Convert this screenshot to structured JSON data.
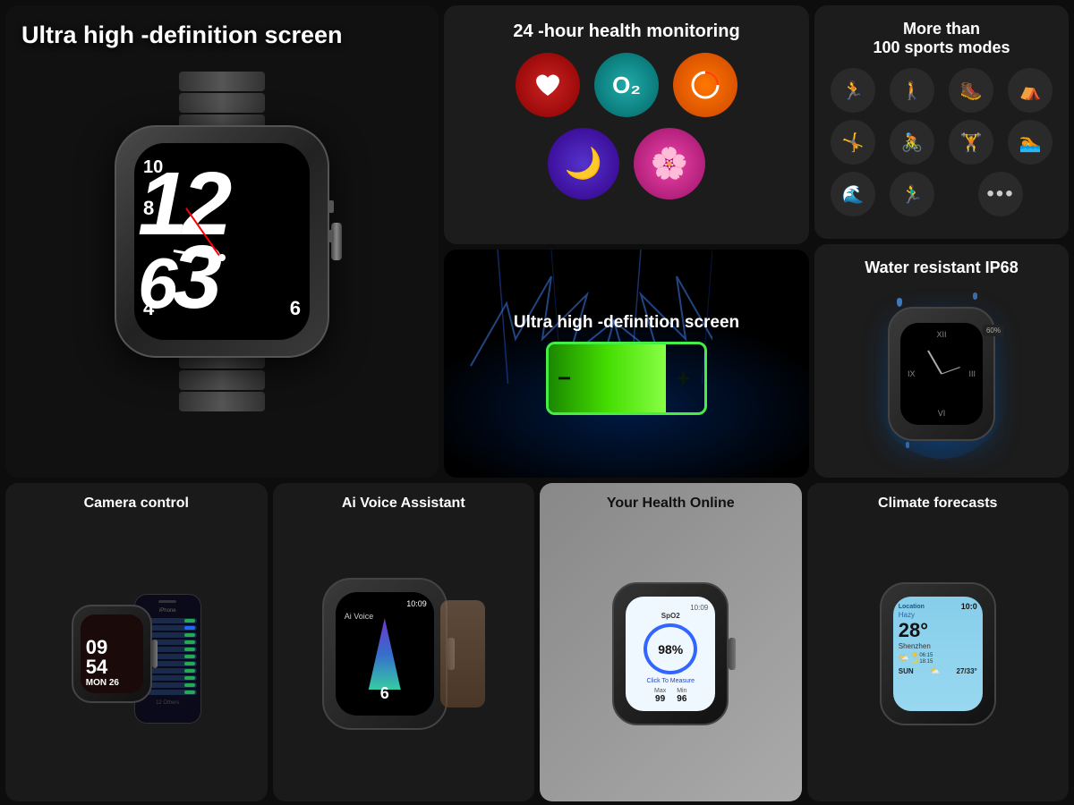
{
  "top_main": {
    "title": "Ultra high -definition screen"
  },
  "health": {
    "title": "24 -hour health monitoring",
    "icons": [
      {
        "emoji": "❤️",
        "bg": "#cc2222",
        "label": "heart-rate"
      },
      {
        "emoji": "💧",
        "bg": "#22aaaa",
        "label": "oxygen"
      },
      {
        "emoji": "🔄",
        "bg": "#ff7700",
        "label": "activity"
      },
      {
        "emoji": "🌙",
        "bg": "#7744cc",
        "label": "sleep"
      },
      {
        "emoji": "🌸",
        "bg": "#dd44aa",
        "label": "health-app"
      }
    ]
  },
  "sports": {
    "title": "More than\n100 sports modes",
    "icons": [
      {
        "emoji": "🏃",
        "color": "white",
        "label": "running"
      },
      {
        "emoji": "🚶",
        "color": "white",
        "label": "walking"
      },
      {
        "emoji": "🏔️",
        "color": "white",
        "label": "hiking"
      },
      {
        "emoji": "🏕️",
        "color": "white",
        "label": "outdoor"
      },
      {
        "emoji": "🤸",
        "color": "red",
        "label": "exercise"
      },
      {
        "emoji": "🚴",
        "color": "teal",
        "label": "cycling"
      },
      {
        "emoji": "🏋️",
        "color": "teal",
        "label": "gym"
      },
      {
        "emoji": "🏊",
        "color": "yellow",
        "label": "swimming"
      },
      {
        "emoji": "🌊",
        "color": "teal",
        "label": "water-sports"
      },
      {
        "emoji": "🏃‍♂️",
        "color": "orange",
        "label": "sprint"
      },
      {
        "emoji": "⋯",
        "color": "white",
        "label": "more"
      }
    ]
  },
  "battery": {
    "title": "Ultra high -definition screen",
    "minus": "−",
    "plus": "+"
  },
  "water": {
    "title": "Water resistant IP68"
  },
  "camera": {
    "title": "Camera control",
    "time": "09\n54",
    "day": "MON 26"
  },
  "voice": {
    "title": "Ai Voice Assistant",
    "time": "10:09"
  },
  "health_online": {
    "title": "Your Health Online",
    "spo2_label": "SpO2",
    "percent": "98%",
    "cta": "Click To Measure",
    "max_label": "Max",
    "max_val": "99",
    "min_label": "Min",
    "min_val": "96",
    "time": "10:09"
  },
  "climate": {
    "title": "Climate forecasts",
    "condition": "Hazy",
    "temp": "28°",
    "city": "Shenzhen",
    "sunrise": "06:15",
    "sunset": "18:15",
    "day": "SUN",
    "temp_range": "27/33°",
    "top_time": "10:0"
  }
}
